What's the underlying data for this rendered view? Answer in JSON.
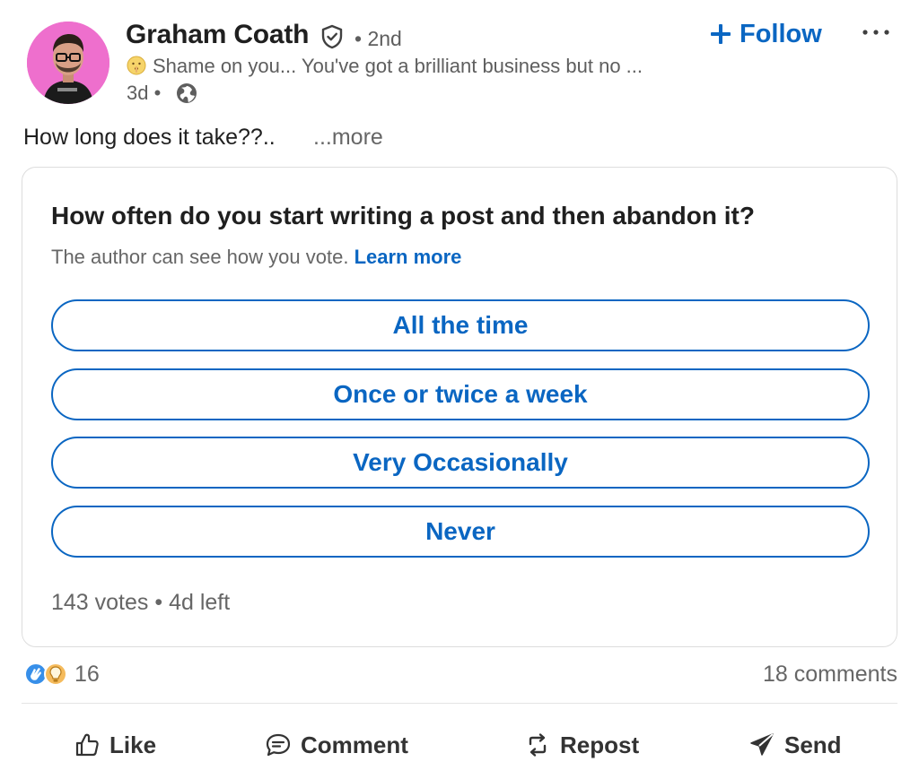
{
  "author": {
    "name": "Graham Coath",
    "degree": "• 2nd",
    "headline": "Shame on you... You've got a brilliant business but no ...",
    "timestamp": "3d •"
  },
  "follow": {
    "label": "Follow"
  },
  "post": {
    "text": "How long does it take??..",
    "see_more": "...more"
  },
  "poll": {
    "question": "How often do you start writing a post and then abandon it?",
    "note": "The author can see how you vote.",
    "learn_more": "Learn more",
    "options": [
      "All the time",
      "Once or twice a week",
      "Very Occasionally",
      "Never"
    ],
    "votes": "143 votes",
    "separator": "•",
    "time_left": "4d left"
  },
  "social": {
    "reactions_count": "16",
    "comments": "18 comments"
  },
  "actions": {
    "like": "Like",
    "comment": "Comment",
    "repost": "Repost",
    "send": "Send"
  },
  "icons": {
    "verified": "shield-check-icon",
    "headline_emoji": "shushing-face-emoji",
    "visibility": "globe-icon",
    "follow": "plus-icon",
    "menu": "more-horizontal-icon",
    "reactions": [
      "clap-reaction-icon",
      "insightful-bulb-icon"
    ]
  },
  "colors": {
    "accent": "#0a66c2",
    "avatar_bg": "#ee6fcd",
    "text_primary": "#1f1f1f",
    "text_secondary": "#666666"
  }
}
